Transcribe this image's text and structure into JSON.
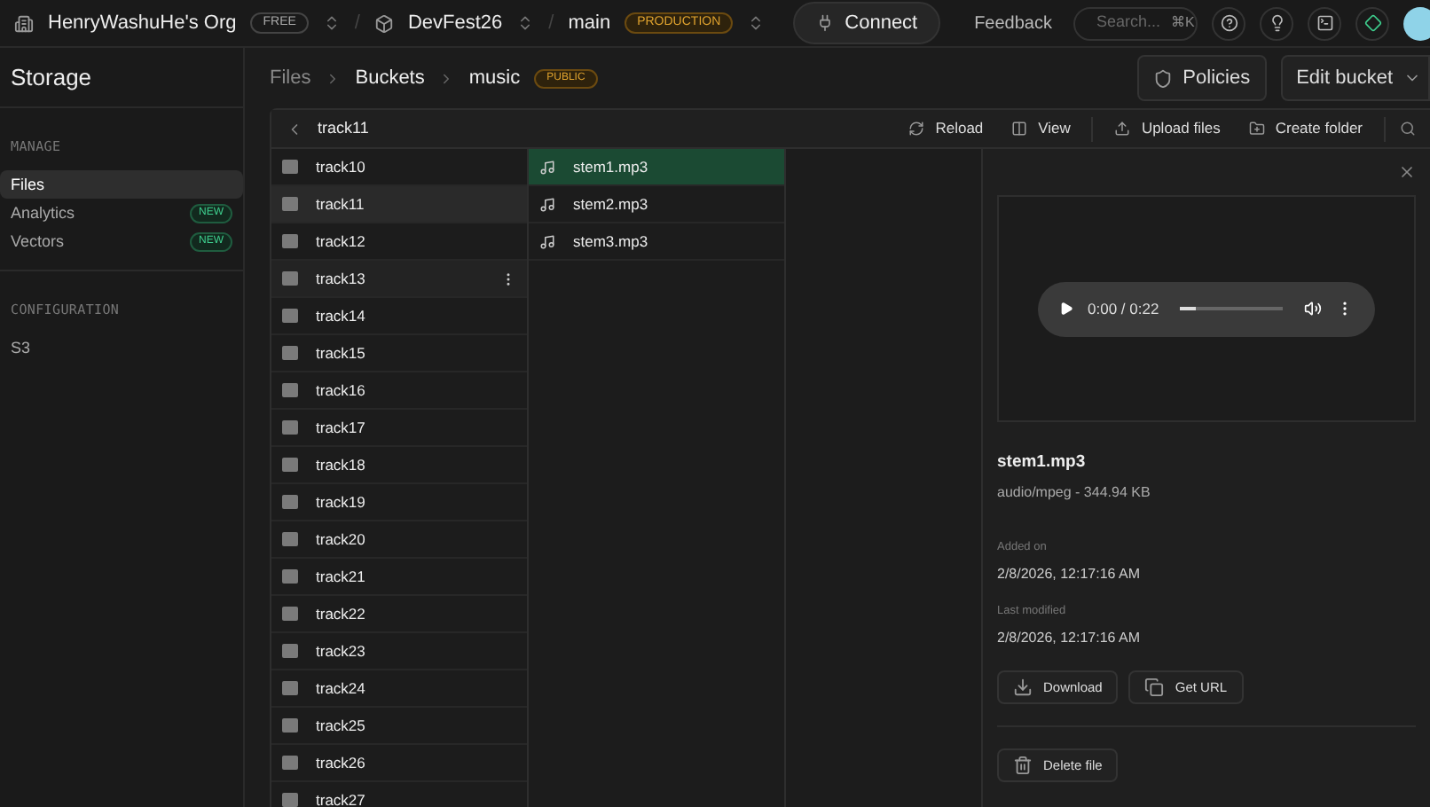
{
  "topbar": {
    "separator": "/",
    "org": "HenryWashuHe's Org",
    "org_badge": "FREE",
    "project": "DevFest26",
    "branch": "main",
    "branch_badge": "PRODUCTION",
    "connect": "Connect",
    "feedback": "Feedback",
    "search": {
      "placeholder": "Search..."
    },
    "shortcut": "⌘K"
  },
  "sidebar": {
    "title": "Storage",
    "sections": [
      {
        "heading": "MANAGE",
        "items": [
          {
            "label": "Files",
            "selected": true
          },
          {
            "label": "Analytics",
            "badge": "NEW",
            "selected": false
          },
          {
            "label": "Vectors",
            "badge": "NEW",
            "selected": false
          }
        ]
      },
      {
        "heading": "CONFIGURATION",
        "items": [
          {
            "label": "S3",
            "selected": false
          }
        ]
      }
    ]
  },
  "breadcrumb": [
    "Files",
    "Buckets",
    "music"
  ],
  "bucket_badge": "PUBLIC",
  "actions": {
    "policies": "Policies",
    "edit": "Edit bucket"
  },
  "browser": {
    "path": "track11",
    "toolbar": [
      "Reload",
      "View",
      "Upload files",
      "Create folder"
    ],
    "folders": [
      {
        "name": "track10",
        "selected": false,
        "hovered": false
      },
      {
        "name": "track11",
        "selected": true,
        "hovered": false
      },
      {
        "name": "track12",
        "selected": false,
        "hovered": false
      },
      {
        "name": "track13",
        "selected": false,
        "hovered": true
      },
      {
        "name": "track14",
        "selected": false,
        "hovered": false
      },
      {
        "name": "track15",
        "selected": false,
        "hovered": false
      },
      {
        "name": "track16",
        "selected": false,
        "hovered": false
      },
      {
        "name": "track17",
        "selected": false,
        "hovered": false
      },
      {
        "name": "track18",
        "selected": false,
        "hovered": false
      },
      {
        "name": "track19",
        "selected": false,
        "hovered": false
      },
      {
        "name": "track20",
        "selected": false,
        "hovered": false
      },
      {
        "name": "track21",
        "selected": false,
        "hovered": false
      },
      {
        "name": "track22",
        "selected": false,
        "hovered": false
      },
      {
        "name": "track23",
        "selected": false,
        "hovered": false
      },
      {
        "name": "track24",
        "selected": false,
        "hovered": false
      },
      {
        "name": "track25",
        "selected": false,
        "hovered": false
      },
      {
        "name": "track26",
        "selected": false,
        "hovered": false
      },
      {
        "name": "track27",
        "selected": false,
        "hovered": false
      }
    ],
    "files": [
      {
        "name": "stem1.mp3",
        "selected": true
      },
      {
        "name": "stem2.mp3",
        "selected": false
      },
      {
        "name": "stem3.mp3",
        "selected": false
      }
    ]
  },
  "preview": {
    "player": {
      "time": "0:00 / 0:22",
      "level": 0.15
    },
    "name": "stem1.mp3",
    "meta": "audio/mpeg - 344.94 KB",
    "added_label": "Added on",
    "added": "2/8/2026, 12:17:16 AM",
    "modified_label": "Last modified",
    "modified": "2/8/2026, 12:17:16 AM",
    "buttons": [
      "Download",
      "Get URL"
    ],
    "delete": "Delete file"
  }
}
